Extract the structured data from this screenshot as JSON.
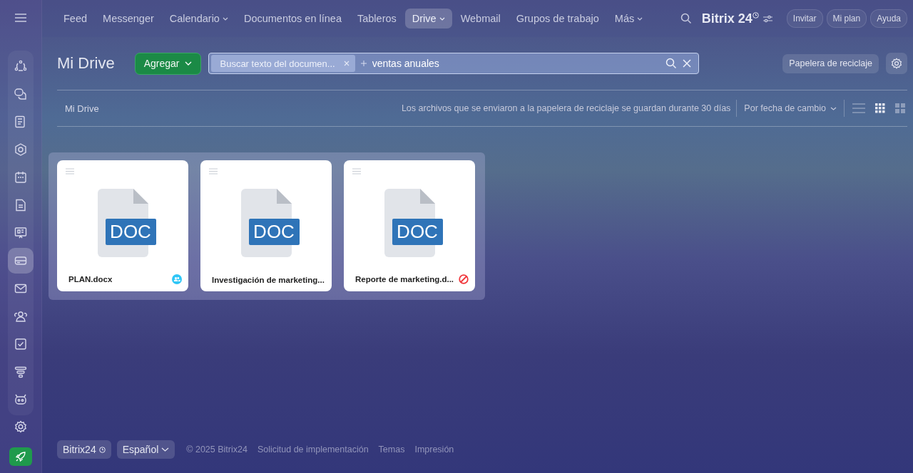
{
  "sidebar": {
    "items": [
      {
        "selected": false
      },
      {
        "selected": false
      },
      {
        "selected": false
      },
      {
        "selected": false
      },
      {
        "selected": false
      },
      {
        "selected": false
      },
      {
        "selected": false
      },
      {
        "selected": true
      },
      {
        "selected": false
      },
      {
        "selected": false
      },
      {
        "selected": false
      },
      {
        "selected": false
      },
      {
        "selected": false
      }
    ]
  },
  "top_nav": {
    "items": [
      {
        "label": "Feed",
        "selected": false,
        "has_menu": false
      },
      {
        "label": "Messenger",
        "selected": false,
        "has_menu": false
      },
      {
        "label": "Calendario",
        "selected": false,
        "has_menu": true
      },
      {
        "label": "Documentos en línea",
        "selected": false,
        "has_menu": false
      },
      {
        "label": "Tableros",
        "selected": false,
        "has_menu": false
      },
      {
        "label": "Drive",
        "selected": true,
        "has_menu": true
      },
      {
        "label": "Webmail",
        "selected": false,
        "has_menu": false
      },
      {
        "label": "Grupos de trabajo",
        "selected": false,
        "has_menu": false
      },
      {
        "label": "Más",
        "selected": false,
        "has_menu": true
      }
    ],
    "logo": "Bitrix 24",
    "buttons": [
      "Invitar",
      "Mi plan",
      "Ayuda"
    ]
  },
  "header": {
    "title": "Mi Drive",
    "add_button": "Agregar",
    "search": {
      "chip": "Buscar texto del documen...",
      "value": "ventas anuales"
    },
    "trash_button": "Papelera de reciclaje"
  },
  "toolbar": {
    "breadcrumb": "Mi Drive",
    "notice": "Los archivos que se enviaron a la papelera de reciclaje se guardan durante 30 días",
    "sort": "Por fecha de cambio",
    "views": [
      {
        "selected": false
      },
      {
        "selected": true
      },
      {
        "selected": false
      }
    ]
  },
  "files": [
    {
      "name": "PLAN.docx",
      "type_label": "DOC",
      "shared": true,
      "restricted": false
    },
    {
      "name": "Investigación de marketing...",
      "type_label": "DOC",
      "shared": false,
      "restricted": false
    },
    {
      "name": "Reporte de marketing.d...",
      "type_label": "DOC",
      "shared": false,
      "restricted": true
    }
  ],
  "footer": {
    "brand": "Bitrix24",
    "language": "Español",
    "copyright": "© 2025 Bitrix24",
    "links": [
      "Solicitud de implementación",
      "Temas",
      "Impresión"
    ]
  }
}
